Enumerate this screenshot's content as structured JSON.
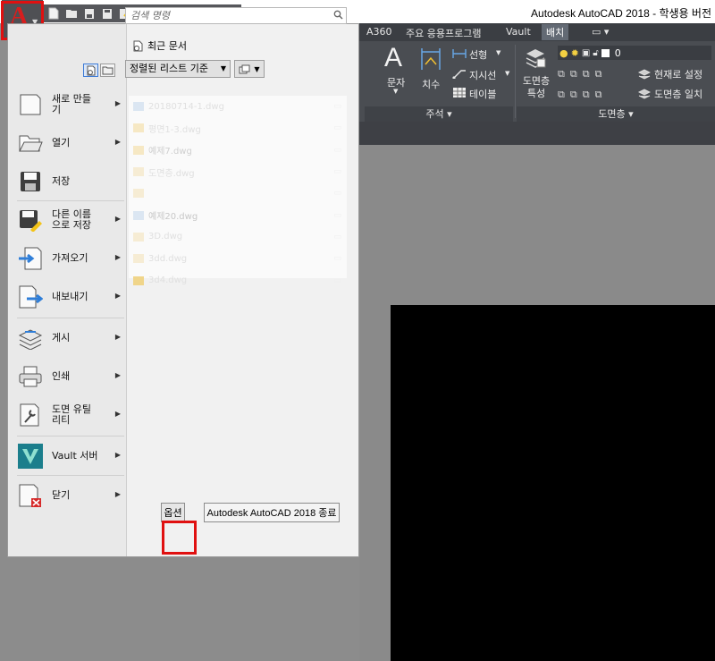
{
  "window": {
    "title": "Autodesk AutoCAD 2018 - 학생용 버전"
  },
  "app_button": {
    "logo": "A"
  },
  "quick_access": {
    "items": [
      "new-icon",
      "open-icon",
      "save-icon",
      "saveas-icon",
      "plot-preview-icon",
      "plot-icon",
      "undo-icon",
      "redo-icon",
      "customize-icon"
    ]
  },
  "ribbon": {
    "tabs": [
      "A360",
      "주요 응용프로그램",
      "Vault",
      "배치"
    ],
    "active_tab": "배치",
    "annotation": {
      "text_label": "문자",
      "dimension_label": "치수",
      "linear_label": "선형",
      "leader_label": "지시선",
      "table_label": "테이블",
      "panel_label": "주석 ▾"
    },
    "layers": {
      "properties_label": "도면층\n특성",
      "current_layer": "0",
      "make_current_label": "현재로 설정",
      "match_layer_label": "도면층 일치",
      "panel_label": "도면층 ▾"
    }
  },
  "menu": {
    "search_placeholder": "검색 명령",
    "items": [
      {
        "label": "새로 만들\n기",
        "icon": "new-document-icon",
        "submenu": true
      },
      {
        "label": "열기",
        "icon": "open-folder-icon",
        "submenu": true
      },
      {
        "label": "저장",
        "icon": "floppy-save-icon",
        "submenu": false
      },
      {
        "label": "다른 이름\n으로 저장",
        "icon": "save-as-icon",
        "submenu": true
      },
      {
        "label": "가져오기",
        "icon": "import-icon",
        "submenu": true
      },
      {
        "label": "내보내기",
        "icon": "export-icon",
        "submenu": true
      },
      {
        "label": "게시",
        "icon": "publish-icon",
        "submenu": true
      },
      {
        "label": "인쇄",
        "icon": "printer-icon",
        "submenu": true
      },
      {
        "label": "도면 유틸\n리티",
        "icon": "drawing-utilities-icon",
        "submenu": true
      },
      {
        "label": "Vault 서버",
        "icon": "vault-icon",
        "submenu": true
      },
      {
        "label": "닫기",
        "icon": "close-document-icon",
        "submenu": true
      }
    ],
    "recent": {
      "title": "최근 문서",
      "sort_label": "정렬된 리스트 기준",
      "files": [
        {
          "name": "20180714-1.dwg",
          "pin": ""
        },
        {
          "name": "평면1-3.dwg",
          "pin": ""
        },
        {
          "name": "예제7.dwg",
          "pin": ""
        },
        {
          "name": "도면층.dwg",
          "pin": ""
        },
        {
          "name": "",
          "pin": ""
        },
        {
          "name": "예제20.dwg",
          "pin": ""
        },
        {
          "name": "3D.dwg",
          "pin": ""
        },
        {
          "name": "3dd.dwg",
          "pin": ""
        },
        {
          "name": "3d4.dwg",
          "pin": ""
        }
      ]
    },
    "options_label": "옵션",
    "exit_label": "Autodesk AutoCAD 2018 종료"
  },
  "colors": {
    "highlight": "#e01010",
    "ribbon_bg": "#4a4d52",
    "paper": "#000000",
    "accent": "#d81e1e"
  }
}
